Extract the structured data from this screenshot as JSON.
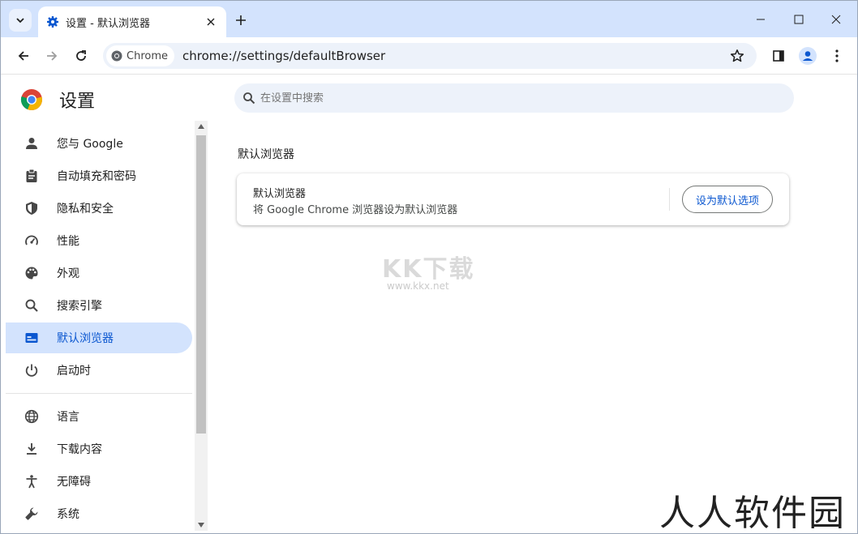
{
  "tab": {
    "title": "设置 - 默认浏览器"
  },
  "toolbar": {
    "chip_label": "Chrome",
    "url": "chrome://settings/defaultBrowser"
  },
  "sidebar": {
    "title": "设置",
    "items": [
      {
        "label": "您与 Google",
        "icon": "person-icon"
      },
      {
        "label": "自动填充和密码",
        "icon": "clipboard-icon"
      },
      {
        "label": "隐私和安全",
        "icon": "shield-icon"
      },
      {
        "label": "性能",
        "icon": "speedometer-icon"
      },
      {
        "label": "外观",
        "icon": "palette-icon"
      },
      {
        "label": "搜索引擎",
        "icon": "search-icon"
      },
      {
        "label": "默认浏览器",
        "icon": "browser-icon",
        "active": true
      },
      {
        "label": "启动时",
        "icon": "power-icon"
      },
      {
        "label": "语言",
        "icon": "globe-icon"
      },
      {
        "label": "下载内容",
        "icon": "download-icon"
      },
      {
        "label": "无障碍",
        "icon": "accessibility-icon"
      },
      {
        "label": "系统",
        "icon": "wrench-icon"
      }
    ]
  },
  "search": {
    "placeholder": "在设置中搜索"
  },
  "main": {
    "section_title": "默认浏览器",
    "card": {
      "title": "默认浏览器",
      "subtitle": "将 Google Chrome 浏览器设为默认浏览器",
      "button_label": "设为默认选项"
    }
  },
  "watermarks": {
    "kk": "KK下载",
    "kk_url": "www.kkx.net",
    "site": "人人软件园"
  },
  "colors": {
    "accent": "#0b57d0",
    "active_bg": "#d3e3fd",
    "tabstrip": "#d3e3fd",
    "omnibox": "#edf2fa"
  }
}
